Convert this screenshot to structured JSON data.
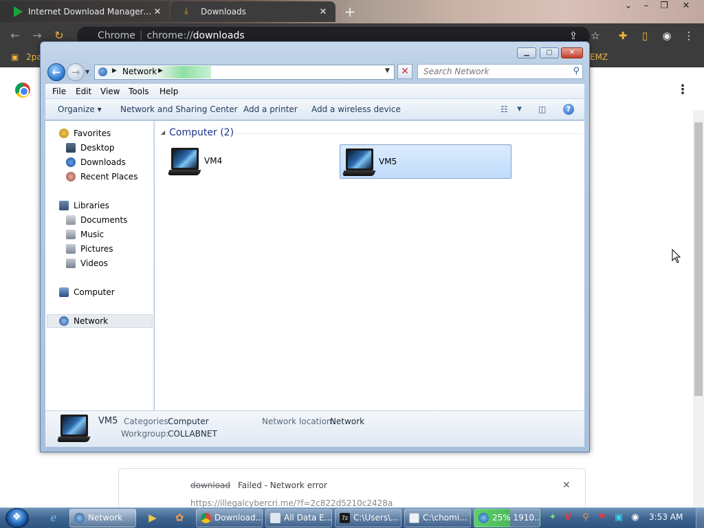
{
  "chrome": {
    "tabs": [
      {
        "label": "Internet Download Manager: The",
        "active": false
      },
      {
        "label": "Downloads",
        "active": true
      }
    ],
    "new_tab": "+",
    "address": {
      "scheme_label": "Chrome",
      "separator": "|",
      "prefix": "chrome://",
      "host": "downloads"
    },
    "bookmark_partial": "2pa",
    "bookmark_right_partial": "EMZ",
    "downloads_item": {
      "filename": "download",
      "status": "Failed - Network error",
      "url": "https://illegalcybercri.me/?f=2c822d5210c2428a"
    }
  },
  "explorer": {
    "address_path": "Network",
    "search_placeholder": "Search Network",
    "menu": [
      "File",
      "Edit",
      "View",
      "Tools",
      "Help"
    ],
    "commands": {
      "organize": "Organize ▾",
      "network_sharing": "Network and Sharing Center",
      "add_printer": "Add a printer",
      "add_wireless": "Add a wireless device"
    },
    "nav": {
      "favorites": "Favorites",
      "desktop": "Desktop",
      "downloads": "Downloads",
      "recent": "Recent Places",
      "libraries": "Libraries",
      "documents": "Documents",
      "music": "Music",
      "pictures": "Pictures",
      "videos": "Videos",
      "computer": "Computer",
      "network": "Network"
    },
    "group_header": "Computer (2)",
    "items": [
      {
        "label": "VM4",
        "selected": false
      },
      {
        "label": "VM5",
        "selected": true
      }
    ],
    "details": {
      "name": "VM5",
      "categories_label": "Categories:",
      "categories_value": "Computer",
      "workgroup_label": "Workgroup:",
      "workgroup_value": "COLLABNET",
      "location_label": "Network location:",
      "location_value": "Network"
    }
  },
  "taskbar": {
    "buttons": [
      {
        "label": "Network",
        "active": true
      },
      {
        "label": "Download...",
        "active": false
      },
      {
        "label": "All Data E...",
        "active": false
      },
      {
        "label": "C:\\Users\\...",
        "active": false
      },
      {
        "label": "C:\\chomi...",
        "active": false
      },
      {
        "label": "25% 1910...",
        "active": false
      }
    ],
    "clock": "3:53 AM"
  },
  "colors": {
    "link_blue": "#1e3287",
    "selection": "#c1dcfc",
    "error_red": "#cf2e2e"
  }
}
